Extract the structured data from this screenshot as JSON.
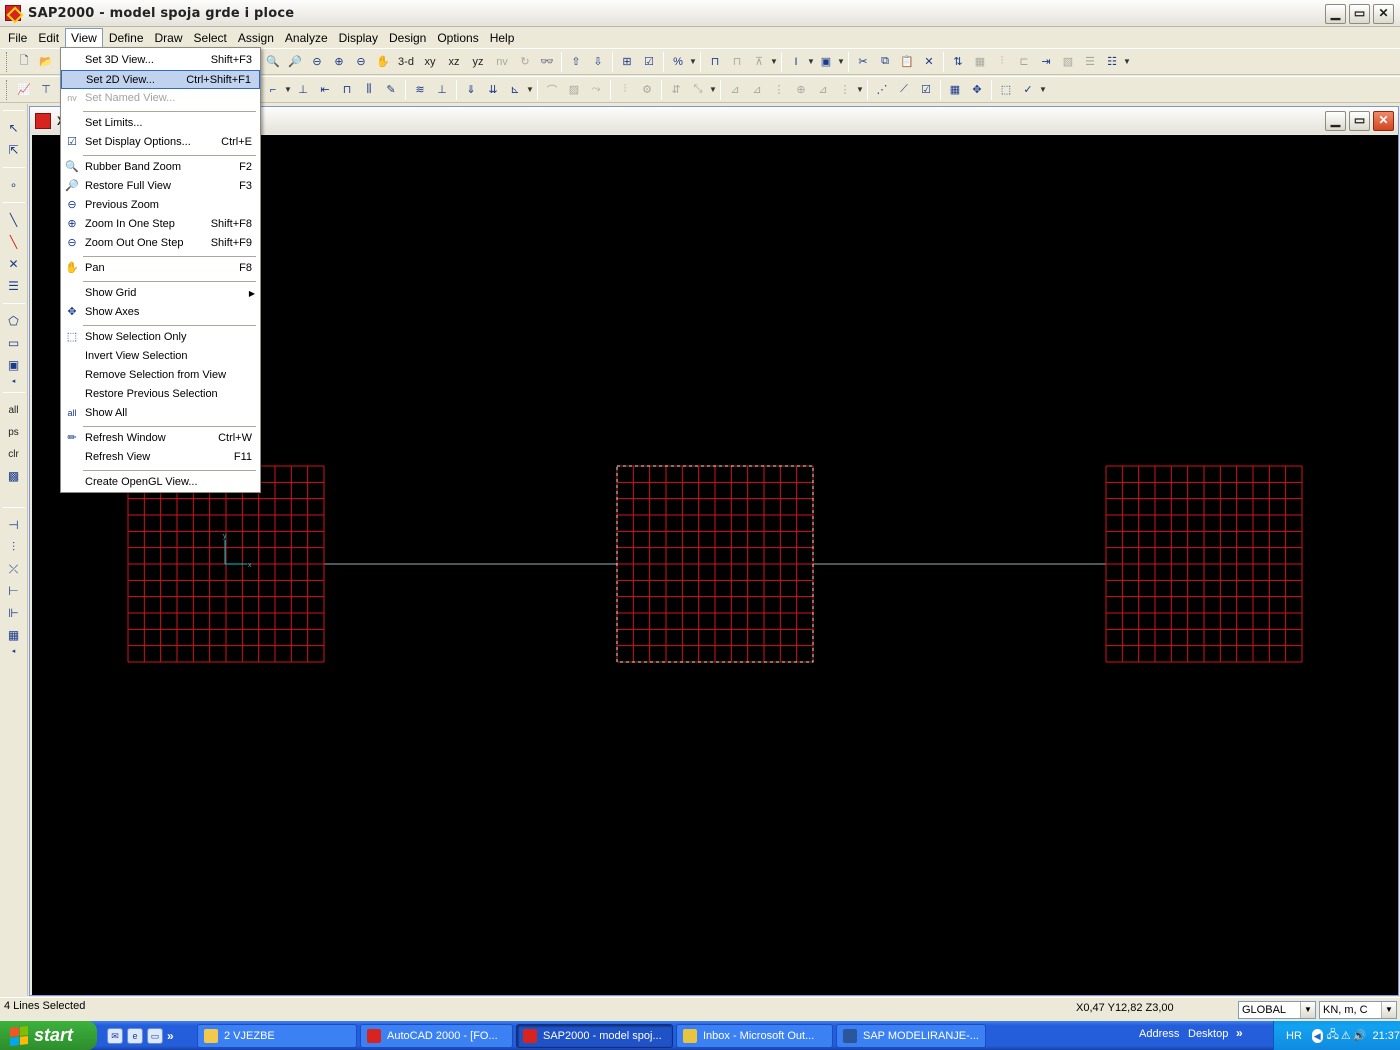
{
  "window": {
    "title": "SAP2000 - model spoja grde i ploce",
    "minimize": "▁",
    "restore": "▭",
    "close": "✕"
  },
  "menubar": [
    {
      "label": "File",
      "key": "file"
    },
    {
      "label": "Edit",
      "key": "edit"
    },
    {
      "label": "View",
      "key": "view"
    },
    {
      "label": "Define",
      "key": "define"
    },
    {
      "label": "Draw",
      "key": "draw"
    },
    {
      "label": "Select",
      "key": "select"
    },
    {
      "label": "Assign",
      "key": "assign"
    },
    {
      "label": "Analyze",
      "key": "analyze"
    },
    {
      "label": "Display",
      "key": "display"
    },
    {
      "label": "Design",
      "key": "design"
    },
    {
      "label": "Options",
      "key": "options"
    },
    {
      "label": "Help",
      "key": "help"
    }
  ],
  "toolbar_text_buttons": {
    "view3d": "3-d",
    "xy": "xy",
    "xz": "xz",
    "yz": "yz",
    "nv": "nv"
  },
  "left_toolbar_text": {
    "all": "all",
    "ps": "ps",
    "clr": "clr"
  },
  "child_window": {
    "title": "X"
  },
  "view_menu": {
    "set_3d_view": {
      "label": "Set 3D View...",
      "shortcut": "Shift+F3"
    },
    "set_2d_view": {
      "label": "Set 2D View...",
      "shortcut": "Ctrl+Shift+F1"
    },
    "set_named_view": {
      "label": "Set Named View...",
      "icon": "nv"
    },
    "set_limits": {
      "label": "Set Limits..."
    },
    "set_display_options": {
      "label": "Set Display Options...",
      "shortcut": "Ctrl+E"
    },
    "rubber_band_zoom": {
      "label": "Rubber Band Zoom",
      "shortcut": "F2"
    },
    "restore_full_view": {
      "label": "Restore Full View",
      "shortcut": "F3"
    },
    "previous_zoom": {
      "label": "Previous Zoom"
    },
    "zoom_in_one_step": {
      "label": "Zoom In One Step",
      "shortcut": "Shift+F8"
    },
    "zoom_out_one_step": {
      "label": "Zoom Out One Step",
      "shortcut": "Shift+F9"
    },
    "pan": {
      "label": "Pan",
      "shortcut": "F8"
    },
    "show_grid": {
      "label": "Show Grid"
    },
    "show_axes": {
      "label": "Show Axes"
    },
    "show_selection_only": {
      "label": "Show Selection Only"
    },
    "invert_view_selection": {
      "label": "Invert View Selection"
    },
    "remove_selection_from_view": {
      "label": "Remove Selection from View"
    },
    "restore_previous_selection": {
      "label": "Restore Previous Selection"
    },
    "show_all": {
      "label": "Show  All"
    },
    "refresh_window": {
      "label": "Refresh Window",
      "shortcut": "Ctrl+W"
    },
    "refresh_view": {
      "label": "Refresh View",
      "shortcut": "F11"
    },
    "create_opengl_view": {
      "label": "Create OpenGL View..."
    }
  },
  "model_view": {
    "background": "#000000",
    "mesh_color": "#d2141e",
    "selection_color": "#f1f0c8",
    "frame_line_color": "#8fb3b3",
    "axis_color": "#00c8c8",
    "mesh_divisions": 12,
    "axis_x_label": "x",
    "axis_y_label": "y"
  },
  "status": {
    "message": "4 Lines Selected",
    "coordinates": "X0,47  Y12,82  Z3,00",
    "coord_system": "GLOBAL",
    "units": "KN, m, C"
  },
  "taskbar": {
    "start": "start",
    "more": "»",
    "tasks": [
      {
        "label": "2 VJEZBE",
        "color": "#f2c94c"
      },
      {
        "label": "AutoCAD 2000 - [FO...",
        "color": "#d8241f"
      },
      {
        "label": "SAP2000 - model spoj...",
        "color": "#d8241f"
      },
      {
        "label": "Inbox - Microsoft Out...",
        "color": "#e8c443"
      },
      {
        "label": "SAP  MODELIRANJE-...",
        "color": "#2b579a"
      }
    ],
    "address": "Address",
    "desktop": "Desktop",
    "lang": "HR",
    "clock": "21:37"
  }
}
